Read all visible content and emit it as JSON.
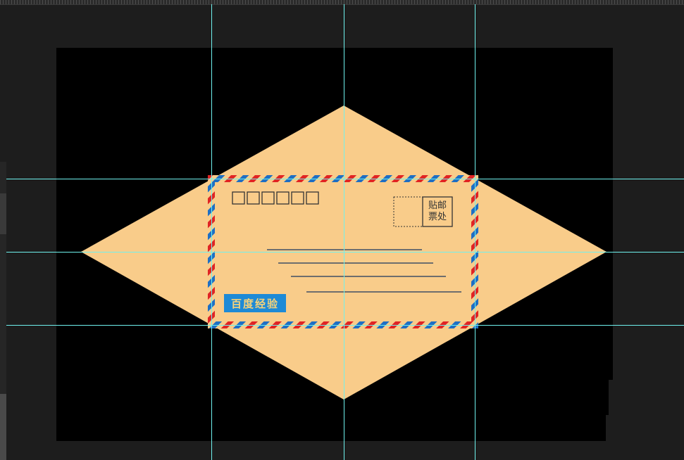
{
  "document": {
    "stamp_label_line1": "贴邮",
    "stamp_label_line2": "票处",
    "brand_badge": "百度经验",
    "postcode_box_count": 6,
    "address_line_count": 4
  },
  "colors": {
    "workspace": "#1d1d1d",
    "canvas": "#000000",
    "envelope": "#f9cc8a",
    "stripe_red": "#e02424",
    "stripe_blue": "#1e6fc4",
    "guide": "#6ff2ee",
    "badge": "#1e8ad6",
    "badge_text": "#f6d27a"
  },
  "icons": {
    "envelope": "airmail-envelope-icon"
  }
}
